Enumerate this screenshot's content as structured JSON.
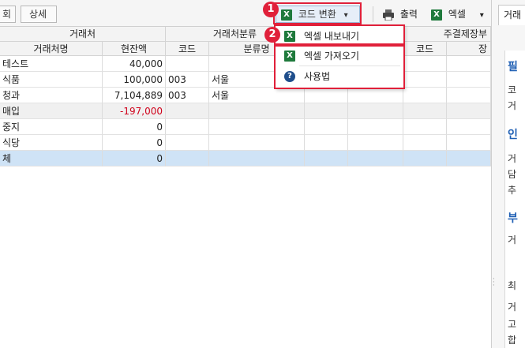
{
  "toolbar": {
    "btn_partial_left": "회",
    "btn_detail": "상세",
    "code_convert": "코드 변환",
    "print": "출력",
    "excel": "엑셀",
    "excel_icon_letter": "X",
    "dropdown_arrow": "▾"
  },
  "menu": {
    "items": [
      {
        "label": "엑셀 내보내기",
        "icon": "excel-export-icon"
      },
      {
        "label": "엑셀 가져오기",
        "icon": "excel-import-icon"
      },
      {
        "label": "사용법",
        "icon": "help-icon",
        "glyph": "?"
      }
    ]
  },
  "annotations": {
    "badge1": "1",
    "badge2": "2"
  },
  "grid": {
    "group_headers": [
      "거래처",
      "거래처분류",
      "주결제장부"
    ],
    "columns": [
      "거래처명",
      "현잔액",
      "코드",
      "분류명",
      "코드",
      "장"
    ],
    "rows": [
      {
        "name": "테스트",
        "balance": "40,000",
        "code": "",
        "category": ""
      },
      {
        "name": "식품",
        "balance": "100,000",
        "code": "003",
        "category": "서울"
      },
      {
        "name": "청과",
        "balance": "7,104,889",
        "code": "003",
        "category": "서울"
      },
      {
        "name": "매입",
        "balance": "-197,000",
        "code": "",
        "category": ""
      },
      {
        "name": "중지",
        "balance": "0",
        "code": "",
        "category": ""
      },
      {
        "name": "식당",
        "balance": "0",
        "code": "",
        "category": ""
      },
      {
        "name": "체",
        "balance": "0",
        "code": "",
        "category": ""
      }
    ]
  },
  "right_panel": {
    "tab_label": "거래",
    "labels": [
      "필",
      "코",
      "거",
      "인",
      "거",
      "담",
      "추",
      "부",
      "거",
      "최",
      "거",
      "고",
      "합"
    ]
  },
  "colors": {
    "accent_red": "#e0203a",
    "selected_row": "#cfe3f6",
    "negative": "#d0021b",
    "excel_green": "#1f7a3c"
  }
}
